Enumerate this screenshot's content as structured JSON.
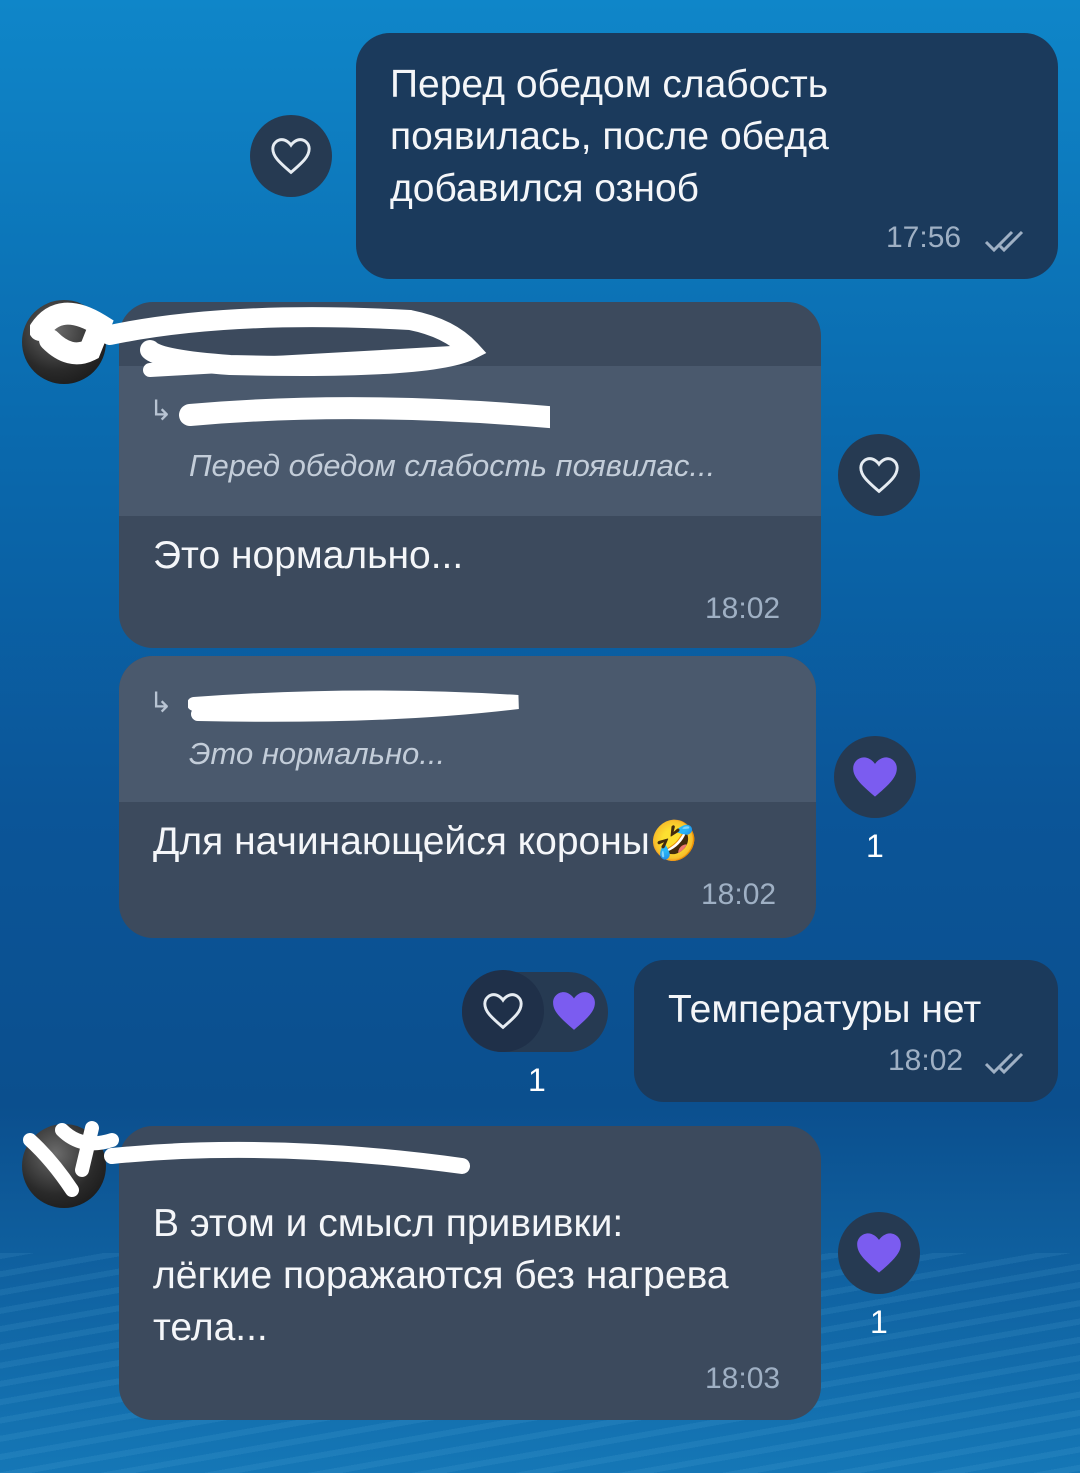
{
  "messages": {
    "m1": {
      "text": "Перед обедом слабость появилась, после обеда добавился озноб",
      "time": "17:56"
    },
    "m2": {
      "quote_text": "Перед обедом слабость появилас...",
      "text": "Это нормально...",
      "time": "18:02"
    },
    "m3": {
      "quote_text": "Это нормально...",
      "text": "Для начинающейся короны",
      "emoji": "🤣",
      "time": "18:02",
      "reaction_count": "1"
    },
    "m4": {
      "text": "Температуры нет",
      "time": "18:02",
      "reaction_count": "1"
    },
    "m5": {
      "text": "В этом и смысл прививки: лёгкие поражаются без нагрева тела...",
      "time": "18:03",
      "reaction_count": "1"
    }
  },
  "icons": {
    "reply_arrow": "↳",
    "heart_outline": "heart-outline-icon",
    "heart_filled": "heart-filled-icon",
    "double_check": "double-check-icon"
  },
  "colors": {
    "incoming_bubble": "#3c4a5d",
    "outgoing_bubble": "#1b3a5c",
    "quote_block": "#4a596d",
    "reaction_heart": "#7b5cf0",
    "reaction_button": "#263a52"
  }
}
